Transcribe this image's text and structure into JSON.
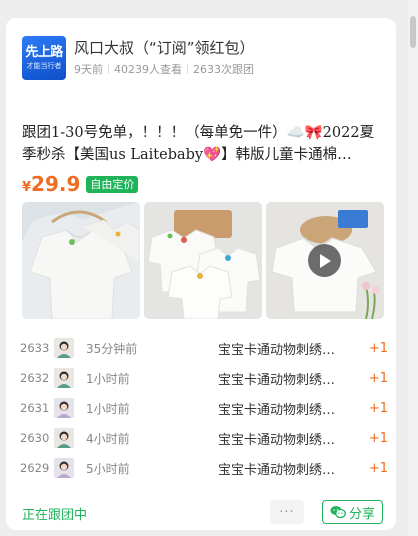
{
  "header": {
    "avatar_line1": "先上路",
    "avatar_line2": "才能当行者",
    "title": "风口大叔（“订阅”领红包）",
    "posted": "9天前",
    "views": "40239人查看",
    "joins": "2633次跟团"
  },
  "post": {
    "title": "跟团1-30号免单，！！！（每单免一件）☁️🎀2022夏季秒杀【美国us Laitebaby💖】韩版儿童卡通棉…",
    "price_currency": "¥",
    "price_value": "29.9",
    "price_tag": "自由定价"
  },
  "images": [
    {
      "icon": "tshirt-hanger-photo"
    },
    {
      "icon": "tshirt-flatlay-photo"
    },
    {
      "icon": "tshirt-video-thumb",
      "has_play": true
    }
  ],
  "rows": [
    {
      "no": "2633",
      "time": "35分钟前",
      "goods": "宝宝卡通动物刺绣…",
      "qty": "+1"
    },
    {
      "no": "2632",
      "time": "1小时前",
      "goods": "宝宝卡通动物刺绣…",
      "qty": "+1"
    },
    {
      "no": "2631",
      "time": "1小时前",
      "goods": "宝宝卡通动物刺绣…",
      "qty": "+1"
    },
    {
      "no": "2630",
      "time": "4小时前",
      "goods": "宝宝卡通动物刺绣…",
      "qty": "+1"
    },
    {
      "no": "2629",
      "time": "5小时前",
      "goods": "宝宝卡通动物刺绣…",
      "qty": "+1"
    }
  ],
  "footer": {
    "status": "正在跟团中",
    "more": "···",
    "share": "分享"
  },
  "colors": {
    "accent_green": "#1fb35a",
    "price_orange": "#f06c22"
  }
}
